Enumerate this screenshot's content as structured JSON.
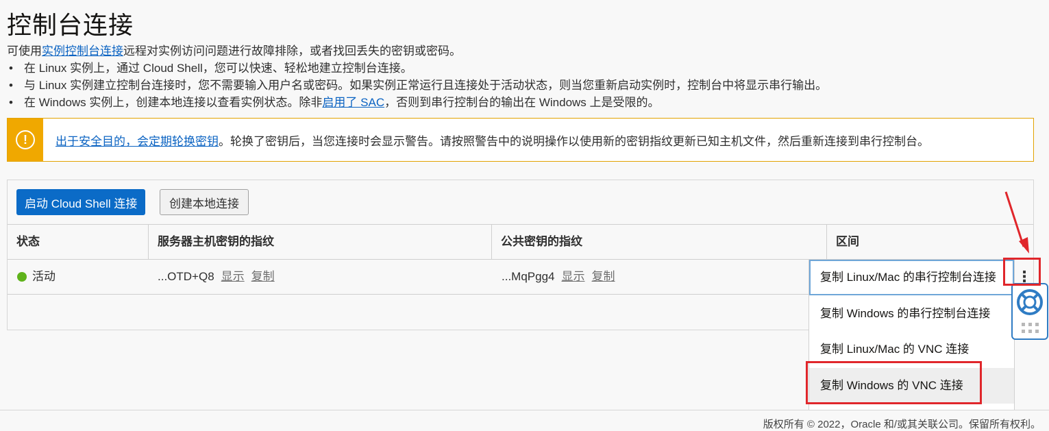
{
  "page": {
    "title": "控制台连接",
    "intro_prefix": "可使用",
    "intro_link": "实例控制台连接",
    "intro_suffix": "远程对实例访问问题进行故障排除，或者找回丢失的密钥或密码。",
    "bullets": {
      "b1": "在 Linux 实例上，通过 Cloud Shell，您可以快速、轻松地建立控制台连接。",
      "b2": "与 Linux 实例建立控制台连接时，您不需要输入用户名或密码。如果实例正常运行且连接处于活动状态，则当您重新启动实例时，控制台中将显示串行输出。",
      "b3_prefix": "在 Windows 实例上，创建本地连接以查看实例状态。除非",
      "b3_link": "启用了 SAC",
      "b3_suffix": "，否则到串行控制台的输出在 Windows 上是受限的。"
    }
  },
  "alert": {
    "icon": "warning-icon",
    "link": "出于安全目的，会定期轮换密钥",
    "text": "。轮换了密钥后，当您连接时会显示警告。请按照警告中的说明操作以使用新的密钥指纹更新已知主机文件，然后重新连接到串行控制台。"
  },
  "toolbar": {
    "primary_button": "启动 Cloud Shell 连接",
    "secondary_button": "创建本地连接"
  },
  "table": {
    "headers": {
      "status": "状态",
      "server_fp": "服务器主机密钥的指纹",
      "public_fp": "公共密钥的指纹",
      "compartment": "区间"
    },
    "row": {
      "status": "活动",
      "server_fp": "...OTD+Q8",
      "public_fp": "...MqPgg4",
      "show": "显示",
      "copy": "复制"
    }
  },
  "menu": {
    "items": [
      "复制 Linux/Mac 的串行控制台连接",
      "复制 Windows 的串行控制台连接",
      "复制 Linux/Mac 的 VNC 连接",
      "复制 Windows 的 VNC 连接"
    ]
  },
  "footer": {
    "copyright": "版权所有 © 2022，Oracle 和/或其关联公司。保留所有权利。"
  },
  "colors": {
    "primary": "#0b6bc7",
    "warning": "#f0a800",
    "active": "#5fb31b",
    "annotation": "#e0262b",
    "link": "#0b63c2"
  }
}
